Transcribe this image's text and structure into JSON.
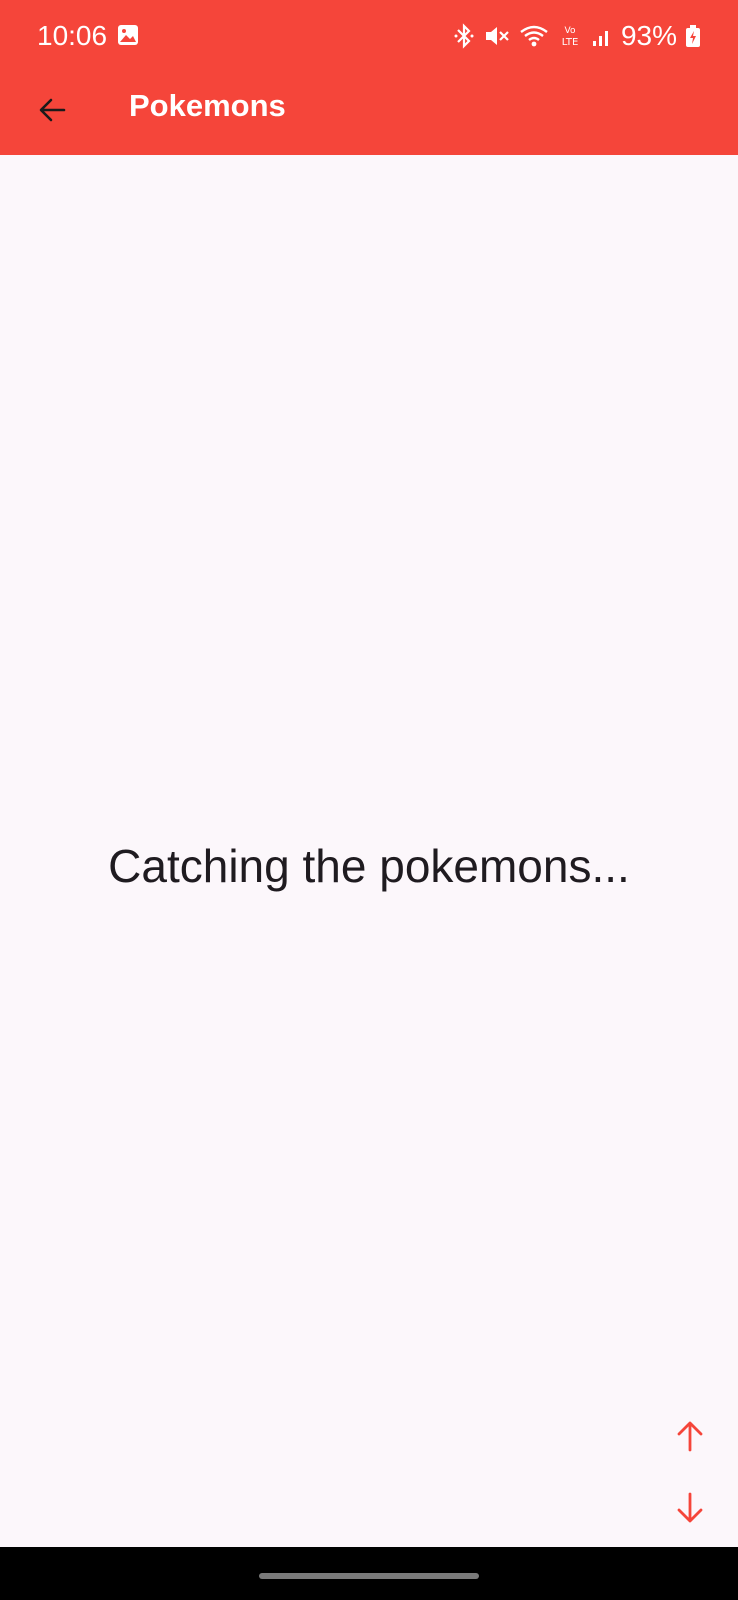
{
  "status_bar": {
    "time": "10:06",
    "battery": "93%",
    "network_label": "LTE",
    "icons": [
      "gallery-icon",
      "bluetooth-icon",
      "mute-icon",
      "wifi-icon",
      "volte-icon",
      "signal-icon",
      "battery-charging-icon"
    ]
  },
  "app_bar": {
    "title": "Pokemons",
    "back_icon": "arrow-left-icon"
  },
  "main": {
    "loading_text": "Catching the pokemons..."
  },
  "scroll_controls": {
    "up_icon": "arrow-up-icon",
    "down_icon": "arrow-down-icon"
  },
  "colors": {
    "primary": "#f5453a",
    "background": "#fcf7fb",
    "text": "#1f1b20",
    "on_primary": "#ffffff"
  }
}
